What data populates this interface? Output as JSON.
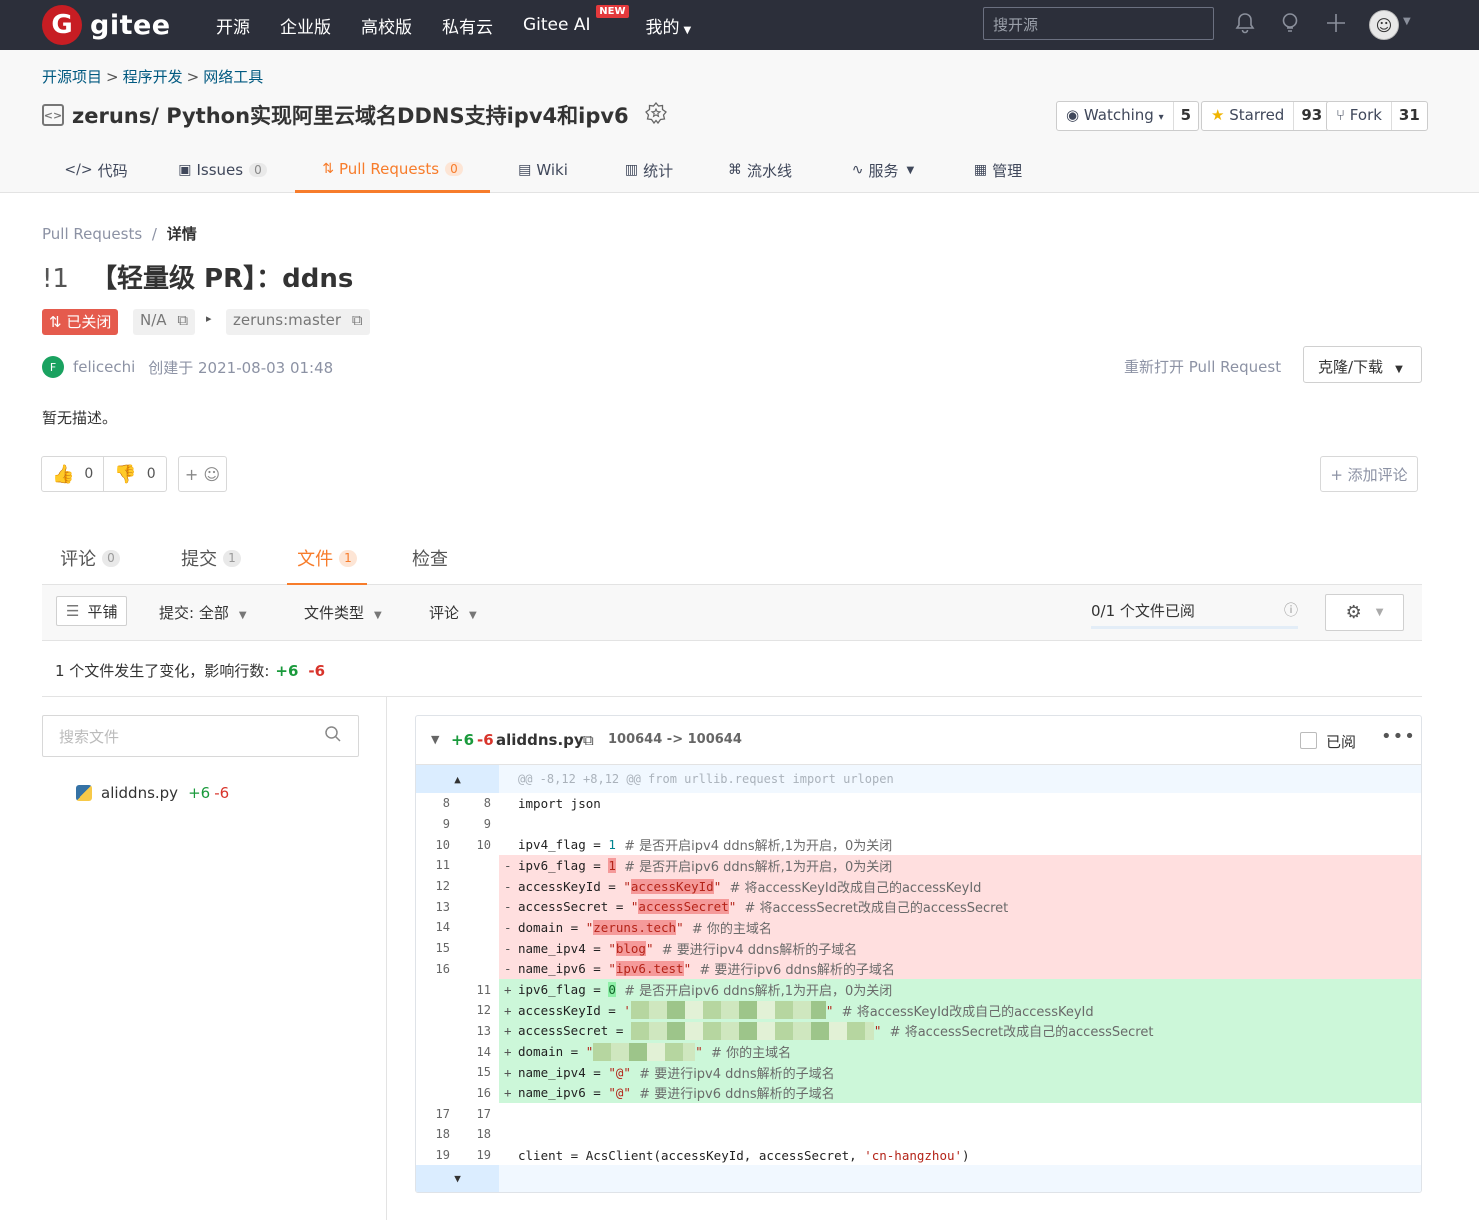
{
  "nav": {
    "logo_text": "gitee",
    "logo_badge": "G",
    "links": [
      "开源",
      "企业版",
      "高校版",
      "私有云",
      "Gitee AI",
      "我的"
    ],
    "new_badge": "NEW",
    "search_placeholder": "搜开源"
  },
  "project": {
    "breadcrumb": [
      "开源项目",
      "程序开发",
      "网络工具"
    ],
    "title": "zeruns/ Python实现阿里云域名DDNS支持ipv4和ipv6",
    "watching_label": "Watching",
    "watching_count": "5",
    "starred_label": "Starred",
    "starred_count": "93",
    "fork_label": "Fork",
    "fork_count": "31",
    "tabs": [
      {
        "label": "代码",
        "count": ""
      },
      {
        "label": "Issues",
        "count": "0"
      },
      {
        "label": "Pull Requests",
        "count": "0"
      },
      {
        "label": "Wiki",
        "count": ""
      },
      {
        "label": "统计",
        "count": ""
      },
      {
        "label": "流水线",
        "count": ""
      },
      {
        "label": "服务",
        "count": ""
      },
      {
        "label": "管理",
        "count": ""
      }
    ]
  },
  "pr": {
    "breadcrumb_root": "Pull Requests",
    "breadcrumb_sep": "/",
    "breadcrumb_current": "详情",
    "number": "!1",
    "title": "【轻量级 PR】：ddns",
    "status": "已关闭",
    "source_branch": "N/A",
    "target_branch": "zeruns:master",
    "author_initial": "F",
    "author": "felicechi",
    "created": "创建于 2021-08-03 01:48",
    "reopen_label": "重新打开 Pull Request",
    "clone_label": "克隆/下载",
    "description": "暂无描述。",
    "thumbs_up": "0",
    "thumbs_down": "0",
    "add_reaction": "+ ☺",
    "add_comment": "+ 添加评论",
    "tabs": [
      {
        "label": "评论",
        "count": "0"
      },
      {
        "label": "提交",
        "count": "1"
      },
      {
        "label": "文件",
        "count": "1"
      },
      {
        "label": "检查",
        "count": ""
      }
    ]
  },
  "toolbar": {
    "flat_label": "平铺",
    "commit_filter": "提交:  全部",
    "file_type_filter": "文件类型",
    "comment_filter": "评论",
    "viewed_status": "0/1 个文件已阅"
  },
  "summary": {
    "text": "1 个文件发生了变化，影响行数:",
    "additions": "+6",
    "deletions": "-6"
  },
  "file_tree": {
    "search_placeholder": "搜索文件",
    "files": [
      {
        "name": "aliddns.py",
        "additions": "+6",
        "deletions": "-6"
      }
    ]
  },
  "diff": {
    "additions": "+6",
    "deletions": "-6",
    "filename": "aliddns.py",
    "mode": "100644 -> 100644",
    "viewed_label": "已阅",
    "hunk_header": "@@ -8,12 +8,12 @@ from urllib.request import urlopen",
    "lines": [
      {
        "type": "ctx",
        "old": "8",
        "new": "8"
      },
      {
        "type": "ctx",
        "old": "9",
        "new": "9"
      },
      {
        "type": "ctx",
        "old": "10",
        "new": "10"
      },
      {
        "type": "del",
        "old": "11",
        "new": ""
      },
      {
        "type": "del",
        "old": "12",
        "new": ""
      },
      {
        "type": "del",
        "old": "13",
        "new": ""
      },
      {
        "type": "del",
        "old": "14",
        "new": ""
      },
      {
        "type": "del",
        "old": "15",
        "new": ""
      },
      {
        "type": "del",
        "old": "16",
        "new": ""
      },
      {
        "type": "add",
        "old": "",
        "new": "11"
      },
      {
        "type": "add",
        "old": "",
        "new": "12"
      },
      {
        "type": "add",
        "old": "",
        "new": "13"
      },
      {
        "type": "add",
        "old": "",
        "new": "14"
      },
      {
        "type": "add",
        "old": "",
        "new": "15"
      },
      {
        "type": "add",
        "old": "",
        "new": "16"
      },
      {
        "type": "ctx",
        "old": "17",
        "new": "17"
      },
      {
        "type": "ctx",
        "old": "18",
        "new": "18"
      },
      {
        "type": "ctx",
        "old": "19",
        "new": "19"
      }
    ],
    "code": {
      "l8": "import json",
      "l10_var": "ipv4_flag = ",
      "l10_val": "1",
      "l10_cmt": "  # 是否开启ipv4 ddns解析,1为开启，0为关闭",
      "d11_var": "ipv6_flag = ",
      "d11_val": "1",
      "d11_cmt": "  # 是否开启ipv6 ddns解析,1为开启，0为关闭",
      "d12_var": "accessKeyId = ",
      "d12_val": "accessKeyId",
      "d12_cmt": "  # 将accessKeyId改成自己的accessKeyId",
      "d13_var": "accessSecret = ",
      "d13_val": "accessSecret",
      "d13_cmt": "  # 将accessSecret改成自己的accessSecret",
      "d14_var": "domain = ",
      "d14_val": "zeruns.tech",
      "d14_cmt": "  # 你的主域名",
      "d15_var": "name_ipv4 = ",
      "d15_val": "blog",
      "d15_cmt": "  # 要进行ipv4 ddns解析的子域名",
      "d16_var": "name_ipv6 = ",
      "d16_val": "ipv6.test",
      "d16_cmt": "  # 要进行ipv6 ddns解析的子域名",
      "a11_var": "ipv6_flag = ",
      "a11_val": "0",
      "a11_cmt": "  # 是否开启ipv6 ddns解析,1为开启，0为关闭",
      "a12_var": "accessKeyId = ",
      "a12_cmt": "  # 将accessKeyId改成自己的accessKeyId",
      "a13_var": "accessSecret = ",
      "a13_cmt": "  # 将accessSecret改成自己的accessSecret",
      "a14_var": "domain = ",
      "a14_cmt": "  # 你的主域名",
      "a15_var": "name_ipv4 = ",
      "a15_val": "@",
      "a15_cmt": "  # 要进行ipv4 ddns解析的子域名",
      "a16_var": "name_ipv6 = ",
      "a16_val": "@",
      "a16_cmt": "  # 要进行ipv6 ddns解析的子域名",
      "l19_pre": "client = AcsClient(accessKeyId, accessSecret, ",
      "l19_str": "'cn-hangzhou'",
      "l19_post": ")"
    }
  }
}
